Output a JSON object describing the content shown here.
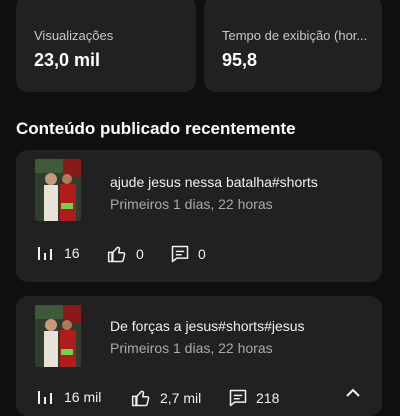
{
  "stats": [
    {
      "label": "Visualizações",
      "value": "23,0 mil"
    },
    {
      "label": "Tempo de exibição (hor...",
      "value": "95,8"
    }
  ],
  "section": {
    "title": "Conteúdo publicado recentemente"
  },
  "videos": [
    {
      "title": "ajude jesus nessa batalha#shorts",
      "subtitle": "Primeiros 1 dias, 22 horas",
      "views": "16",
      "likes": "0",
      "comments": "0"
    },
    {
      "title": "De forças a jesus#shorts#jesus",
      "subtitle": "Primeiros 1 dias, 22 horas",
      "views": "16 mil",
      "likes": "2,7 mil",
      "comments": "218"
    }
  ],
  "icons": {
    "views": "bar-chart-icon",
    "likes": "thumb-up-icon",
    "comments": "comment-icon",
    "expand": "chevron-up-icon"
  },
  "colors": {
    "background": "#0f0f0f",
    "card": "#212121",
    "text_secondary": "#aaaaaa"
  }
}
